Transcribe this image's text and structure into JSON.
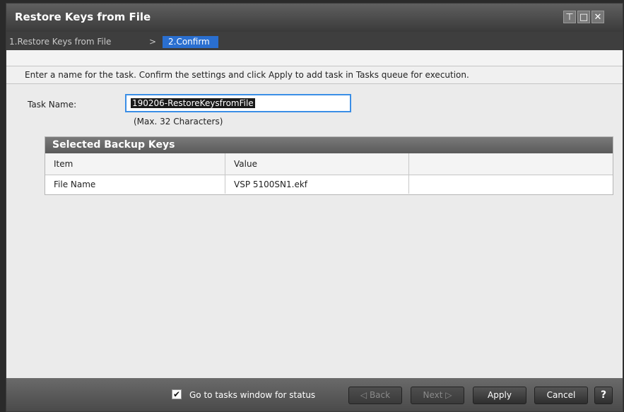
{
  "window": {
    "title": "Restore Keys from File",
    "controls": {
      "restore_icon": "⊤",
      "maximize_icon": "□",
      "close_icon": "✕"
    }
  },
  "wizard": {
    "step1": "1.Restore Keys from File",
    "separator": ">",
    "step2": "2.Confirm"
  },
  "instructions": "Enter a name for the task. Confirm the settings and click Apply to add task in Tasks queue for execution.",
  "task": {
    "label": "Task Name:",
    "value": "190206-RestoreKeysfromFile",
    "hint": "(Max. 32 Characters)"
  },
  "backup_keys": {
    "title": "Selected Backup Keys",
    "columns": [
      "Item",
      "Value",
      ""
    ],
    "rows": [
      {
        "item": "File Name",
        "value": "VSP 5100SN1.ekf"
      }
    ]
  },
  "footer": {
    "checkbox_checked": true,
    "checkbox_label": "Go to tasks window for status",
    "back": "◁ Back",
    "next": "Next ▷",
    "apply": "Apply",
    "cancel": "Cancel",
    "help": "?"
  },
  "colors": {
    "accent": "#2a6fd0",
    "input_focus": "#3a8ee6"
  }
}
